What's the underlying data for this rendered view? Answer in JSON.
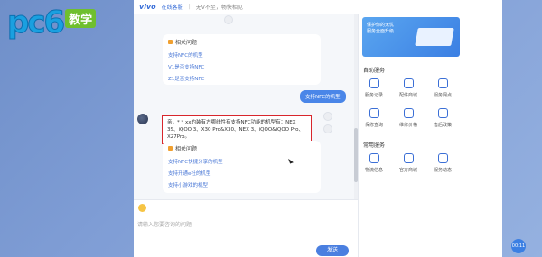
{
  "watermark": {
    "text": "pc6",
    "badge": "教学"
  },
  "topbar": {
    "brand": "vivo",
    "title": "在线客服",
    "slogan": "无V不至，畅快相见"
  },
  "chat": {
    "card1": {
      "heading": "相关问题",
      "links": [
        "支持NFC的机型",
        "V1是否支持NFC",
        "Z1是否支持NFC"
      ]
    },
    "user_message": "支持NFC的机型",
    "answer": "亲，*  * xx的装有方哪线性有支持NFC功能的机型有：NEX 3S、iQOO 3、X30 Pro&X30、NEX 3、iQOO&iQOO Pro、X27Pro。",
    "card2": {
      "heading": "相关问题",
      "links": [
        "支持NFC快捷分享的机型",
        "支持开通e社的机型",
        "支持小游戏的机型"
      ]
    }
  },
  "input": {
    "placeholder": "请输入您要咨询的问题",
    "send_label": "发送"
  },
  "side": {
    "banner_text": "保护你的无忧\n服务全面升级",
    "self_service_title": "自助服务",
    "self_services": [
      "服务记录",
      "配件商城",
      "服务网点",
      "保修查询",
      "维修价格",
      "售后政策"
    ],
    "common_title": "常用服务",
    "common_services": [
      "物流信息",
      "官方商城",
      "服务动态"
    ]
  },
  "fab_label": "00:11"
}
